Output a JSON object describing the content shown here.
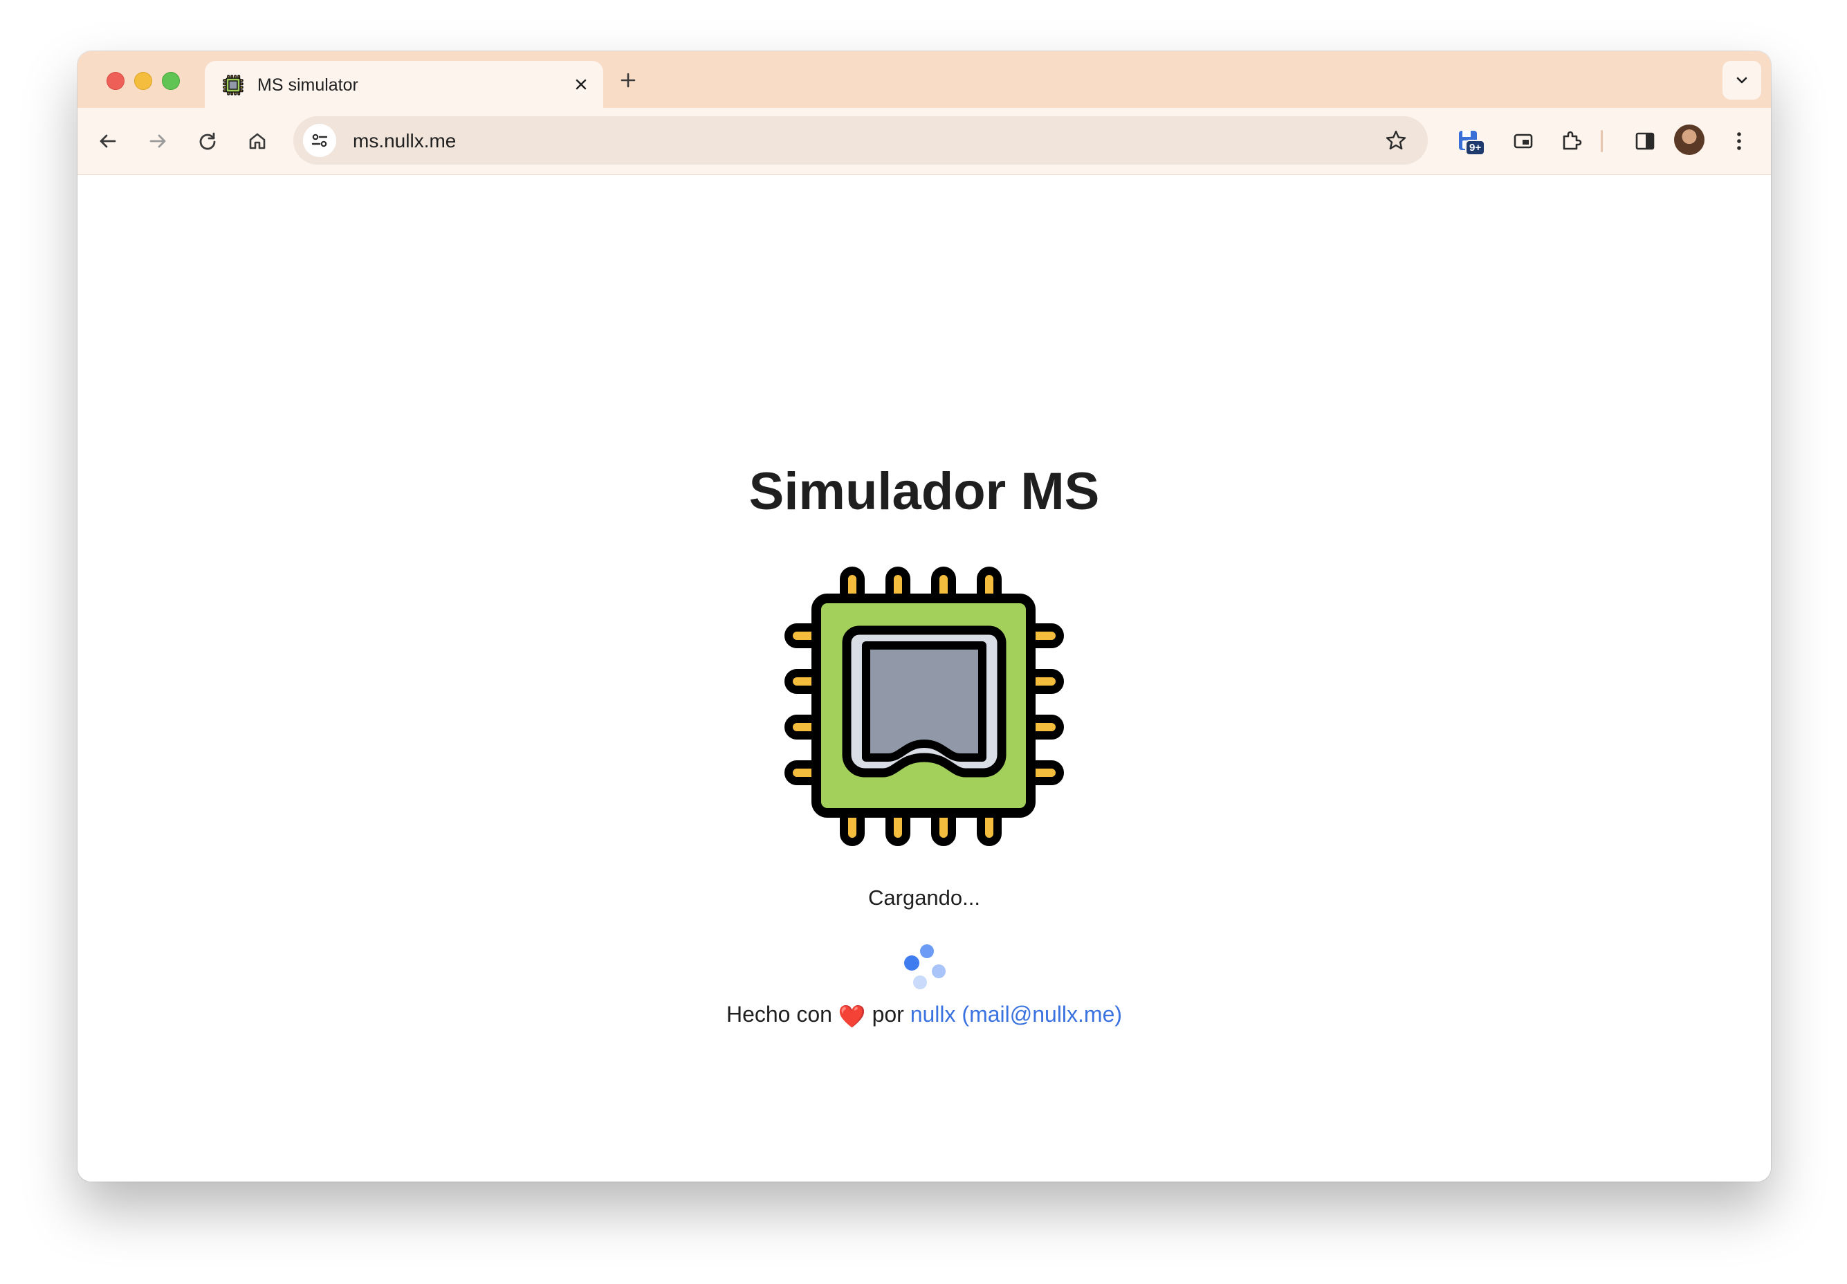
{
  "browser": {
    "tab": {
      "title": "MS simulator",
      "favicon": "cpu-chip-icon"
    },
    "url": "ms.nullx.me",
    "extension_badge": "9+",
    "icons": {
      "back": "arrow-left-icon",
      "forward": "arrow-right-icon",
      "reload": "reload-icon",
      "home": "home-icon",
      "site_info": "tune-icon",
      "bookmark": "star-icon",
      "picture_in_picture": "pip-icon",
      "extensions": "puzzle-icon",
      "side_panel": "side-panel-icon",
      "menu": "kebab-menu-icon"
    },
    "colors": {
      "tabstrip": "#f9dcc6",
      "toolbar": "#fdf4ee"
    }
  },
  "page": {
    "title": "Simulador MS",
    "status": "Cargando...",
    "footer": {
      "prefix": "Hecho con",
      "heart": "❤️",
      "middle": "por",
      "author": "nullx",
      "email": "(mail@nullx.me)"
    },
    "colors": {
      "link": "#3a72e0",
      "chip_board": "#a3d05a",
      "chip_die": "#9198a8",
      "chip_pins": "#f4bd3d",
      "spinner": "#3f7cf0"
    }
  }
}
